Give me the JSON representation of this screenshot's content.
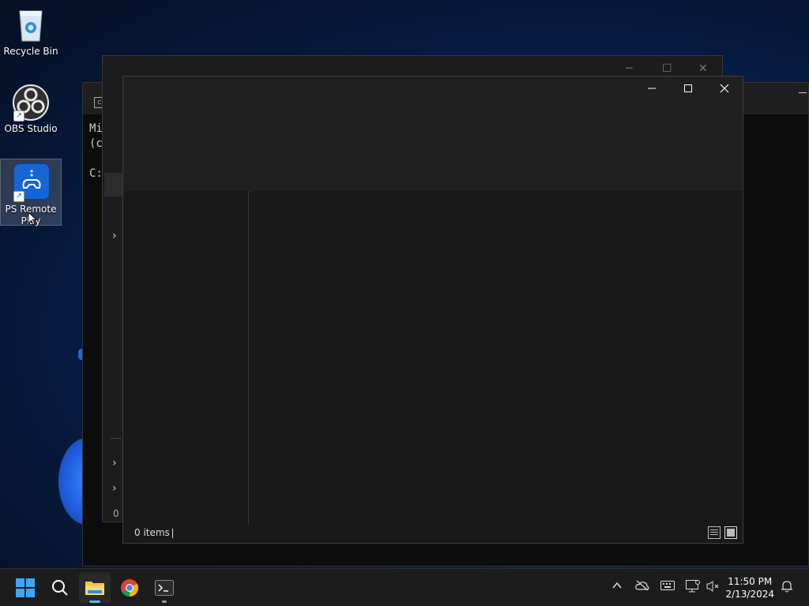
{
  "desktop": {
    "icons": [
      {
        "label": "Recycle Bin"
      },
      {
        "label": "OBS Studio"
      },
      {
        "label": "PS Remote Play"
      }
    ]
  },
  "console": {
    "lines": [
      "Mi",
      "(c",
      "C:"
    ]
  },
  "explorer_back": {
    "status": "0 i"
  },
  "explorer_front": {
    "status_items": "0 items"
  },
  "taskbar": {
    "clock_time": "11:50 PM",
    "clock_date": "2/13/2024"
  },
  "colors": {
    "accent": "#5fb2f2",
    "window_bg": "#191919",
    "header_bg": "#202020",
    "taskbar_bg": "#1c1c1c"
  }
}
